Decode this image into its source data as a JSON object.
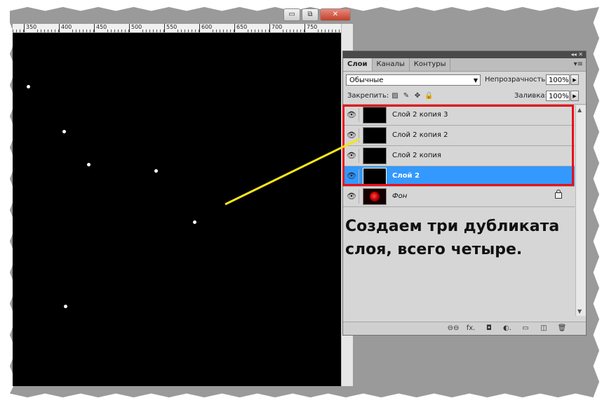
{
  "window": {
    "minimize_glyph": "▭",
    "restore_glyph": "⧉",
    "close_glyph": "✕"
  },
  "ruler": {
    "ticks": [
      "350",
      "400",
      "450",
      "500",
      "550",
      "600",
      "650",
      "700",
      "750"
    ]
  },
  "panel": {
    "tabs": [
      {
        "label": "Слои",
        "active": true
      },
      {
        "label": "Каналы",
        "active": false
      },
      {
        "label": "Контуры",
        "active": false
      }
    ],
    "panel_controls": "◂◂ ✕",
    "panel_menu_glyph": "▾≡",
    "blend_mode": "Обычные",
    "opacity_label": "Непрозрачность:",
    "opacity_value": "100%",
    "lock_label": "Закрепить:",
    "fill_label": "Заливка:",
    "fill_value": "100%",
    "lock_icons": [
      "▨",
      "✎",
      "✥",
      "🔒"
    ],
    "layers": [
      {
        "name": "Слой 2 копия 3",
        "selected": false,
        "visible": true
      },
      {
        "name": "Слой 2 копия 2",
        "selected": false,
        "visible": true
      },
      {
        "name": "Слой 2 копия",
        "selected": false,
        "visible": true
      },
      {
        "name": "Слой 2",
        "selected": true,
        "visible": true
      },
      {
        "name": "Фон",
        "selected": false,
        "visible": true,
        "locked": true
      }
    ],
    "bottom_icons": [
      "link-icon",
      "fx-icon",
      "mask-icon",
      "adjustment-icon",
      "group-icon",
      "new-layer-icon",
      "trash-icon"
    ],
    "bottom_glyphs": [
      "⊖⊖",
      "fx.",
      "◘",
      "◐.",
      "▭",
      "◫",
      "🗑"
    ]
  },
  "annotation": {
    "text": "Создаем три дубликата слоя, всего четыре.",
    "highlight_color": "#e8101a",
    "arrow_color": "#f5e51b"
  },
  "colors": {
    "selection": "#3399ff",
    "canvas": "#000000"
  }
}
